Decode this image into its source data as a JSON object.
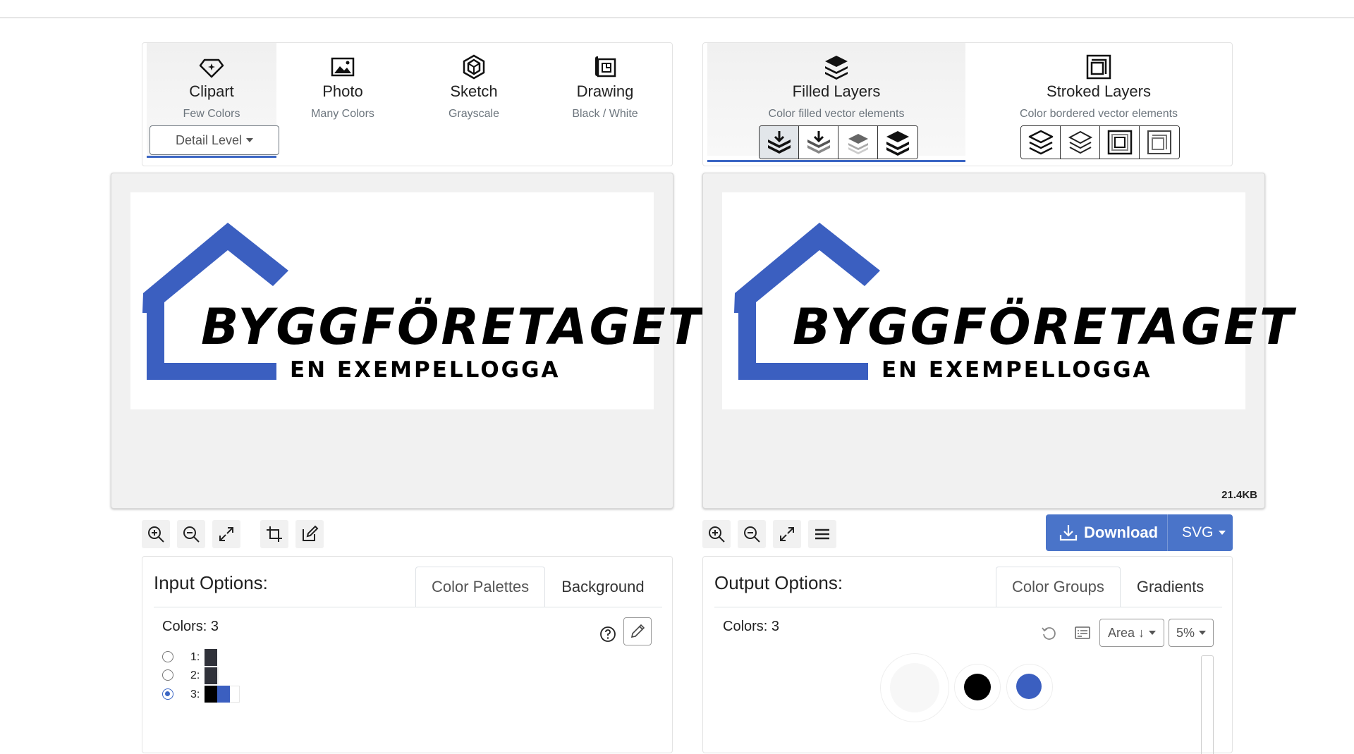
{
  "input_modes": [
    {
      "title": "Clipart",
      "subtitle": "Few Colors",
      "icon": "diamond-icon",
      "active": true
    },
    {
      "title": "Photo",
      "subtitle": "Many Colors",
      "icon": "image-icon",
      "active": false
    },
    {
      "title": "Sketch",
      "subtitle": "Grayscale",
      "icon": "hexagon-icon",
      "active": false
    },
    {
      "title": "Drawing",
      "subtitle": "Black / White",
      "icon": "blueprint-icon",
      "active": false
    }
  ],
  "detail_level_label": "Detail Level",
  "output_modes": [
    {
      "title": "Filled Layers",
      "subtitle": "Color filled vector elements",
      "icon": "layers-filled-icon",
      "active": true
    },
    {
      "title": "Stroked Layers",
      "subtitle": "Color bordered vector elements",
      "icon": "squares-stroked-icon",
      "active": false
    }
  ],
  "logo": {
    "line1": "BYGGFÖRETAGET",
    "line2": "EN EXEMPELLOGGA"
  },
  "file_size": "21.4KB",
  "download": {
    "label": "Download",
    "format": "SVG"
  },
  "input_options": {
    "title": "Input Options:",
    "tabs": [
      "Color Palettes",
      "Background"
    ],
    "colors_label": "Colors: 3",
    "palettes": [
      {
        "index": "1:",
        "selected": false,
        "swatches": [
          "#30323a"
        ]
      },
      {
        "index": "2:",
        "selected": false,
        "swatches": [
          "#30323a"
        ]
      },
      {
        "index": "3:",
        "selected": true,
        "swatches": [
          "#000000",
          "#3b5fc0"
        ]
      }
    ]
  },
  "output_options": {
    "title": "Output Options:",
    "tabs": [
      "Color Groups",
      "Gradients"
    ],
    "colors_label": "Colors: 3",
    "sort_label": "Area ↓",
    "threshold_label": "5%",
    "color_groups": [
      "#f7f7f7",
      "#000000",
      "#3b5fc0"
    ]
  },
  "colors": {
    "accent": "#4a74c9",
    "brand_blue": "#3b5fc0"
  }
}
